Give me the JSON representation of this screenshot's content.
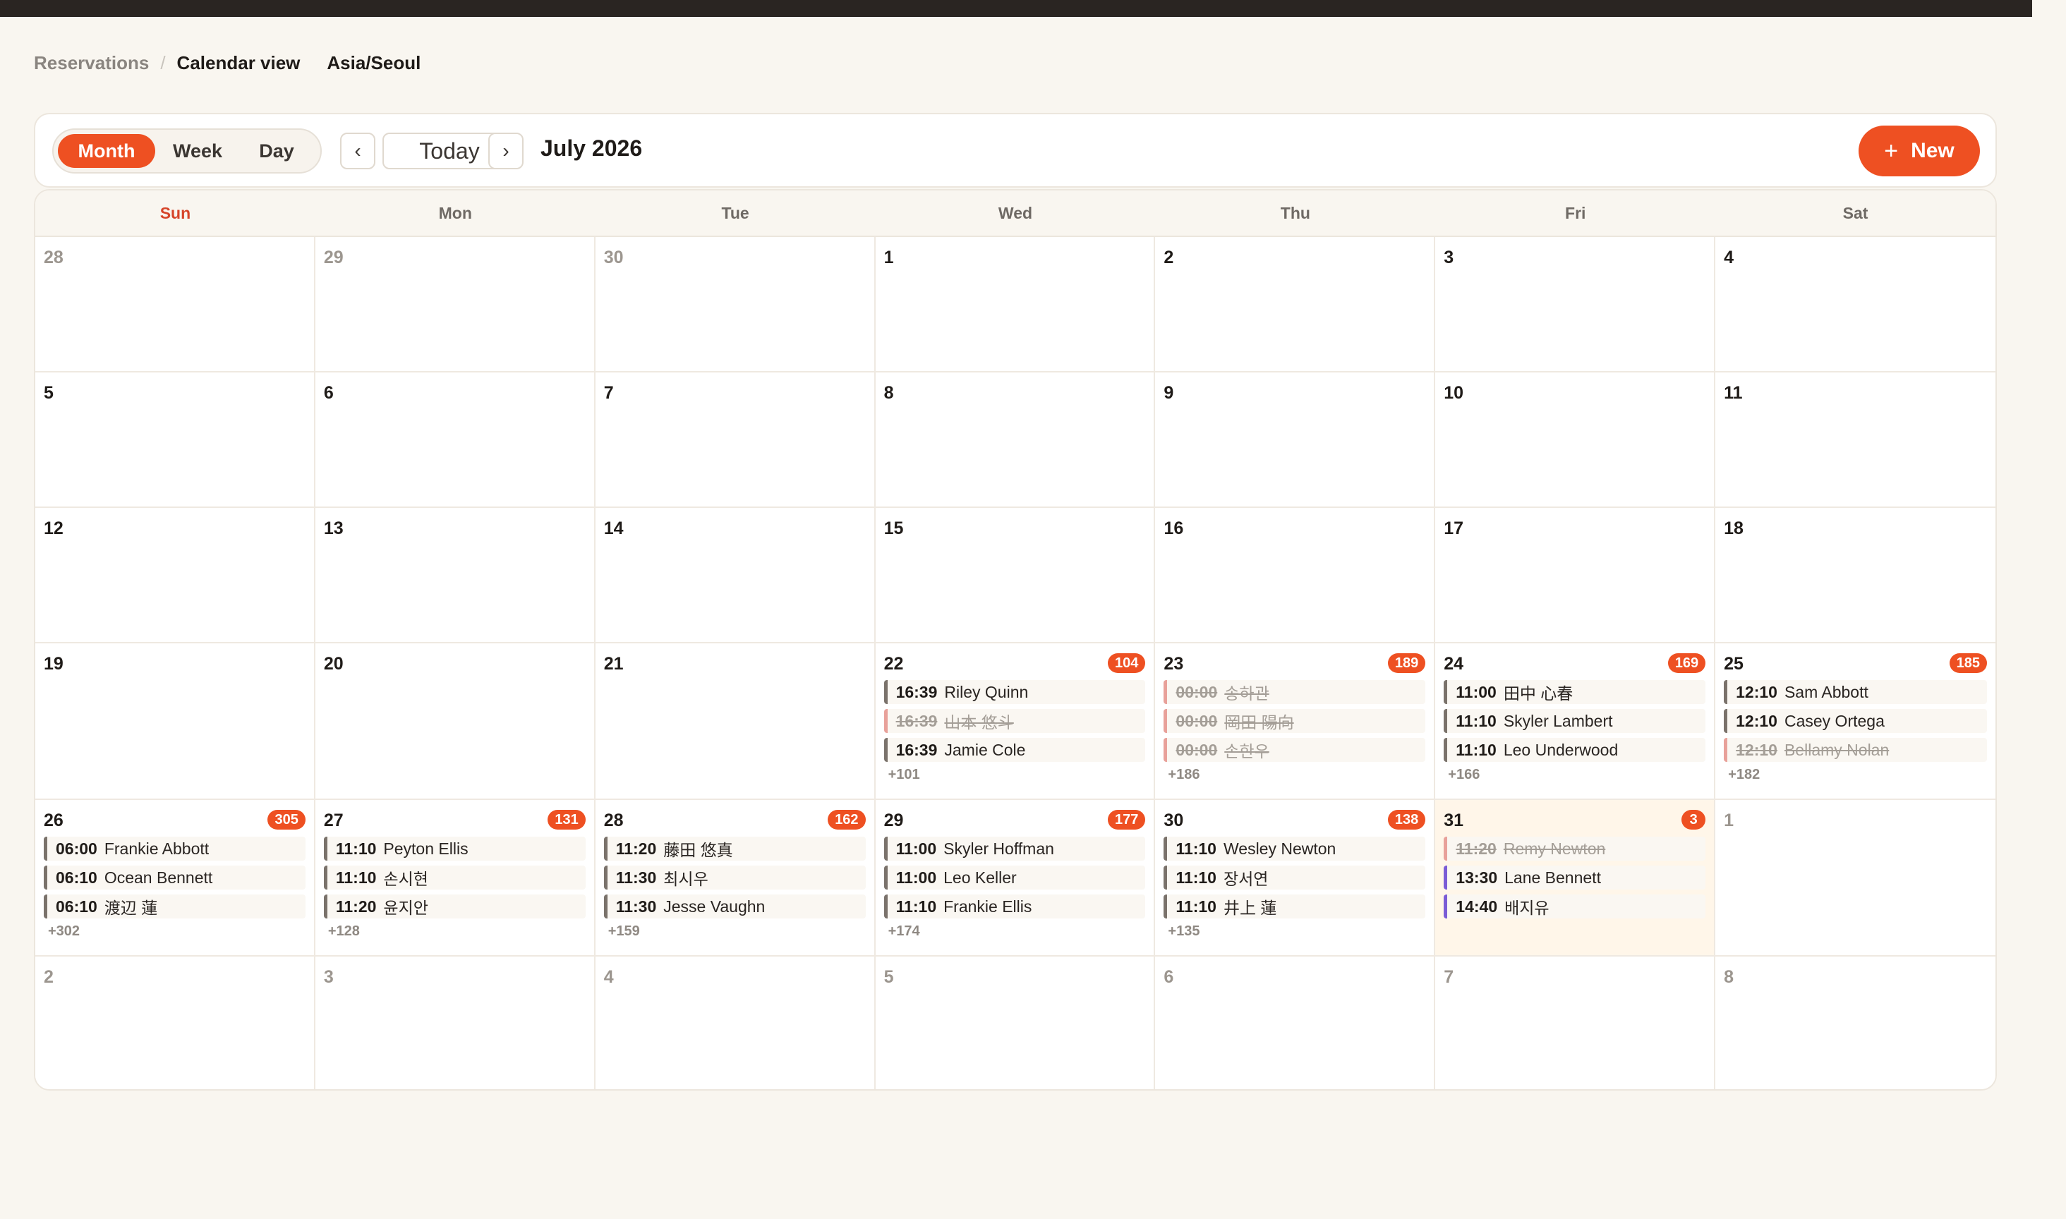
{
  "breadcrumb": {
    "items": [
      "Reservations",
      "Calendar view"
    ],
    "separator": "/",
    "timezone": "Asia/Seoul"
  },
  "toolbar": {
    "views": [
      "Month",
      "Week",
      "Day"
    ],
    "active_view": "Month",
    "prev_label": "‹",
    "today_label": "Today",
    "next_label": "›",
    "month_label": "July 2026",
    "new_label": "New",
    "new_icon": "+"
  },
  "weekdays": [
    "Sun",
    "Mon",
    "Tue",
    "Wed",
    "Thu",
    "Fri",
    "Sat"
  ],
  "colors": {
    "accent": "#ee5022",
    "cancelled": "#e8a19a",
    "default_event": "#7a726b",
    "purple_event": "#7a5cd6",
    "today_bg": "#fff6e9"
  },
  "days": [
    {
      "num": "28",
      "other": true
    },
    {
      "num": "29",
      "other": true
    },
    {
      "num": "30",
      "other": true
    },
    {
      "num": "1"
    },
    {
      "num": "2"
    },
    {
      "num": "3"
    },
    {
      "num": "4"
    },
    {
      "num": "5"
    },
    {
      "num": "6"
    },
    {
      "num": "7"
    },
    {
      "num": "8"
    },
    {
      "num": "9"
    },
    {
      "num": "10"
    },
    {
      "num": "11"
    },
    {
      "num": "12"
    },
    {
      "num": "13"
    },
    {
      "num": "14"
    },
    {
      "num": "15"
    },
    {
      "num": "16"
    },
    {
      "num": "17"
    },
    {
      "num": "18"
    },
    {
      "num": "19"
    },
    {
      "num": "20"
    },
    {
      "num": "21"
    },
    {
      "num": "22",
      "badge": "104",
      "events": [
        {
          "time": "16:39",
          "name": "Riley Quinn"
        },
        {
          "time": "16:39",
          "name": "山本 悠斗",
          "status": "cancelled"
        },
        {
          "time": "16:39",
          "name": "Jamie Cole"
        }
      ],
      "more": "+101"
    },
    {
      "num": "23",
      "badge": "189",
      "events": [
        {
          "time": "00:00",
          "name": "송하관",
          "status": "cancelled"
        },
        {
          "time": "00:00",
          "name": "岡田 陽向",
          "status": "cancelled"
        },
        {
          "time": "00:00",
          "name": "손한우",
          "status": "cancelled"
        }
      ],
      "more": "+186"
    },
    {
      "num": "24",
      "badge": "169",
      "events": [
        {
          "time": "11:00",
          "name": "田中 心春"
        },
        {
          "time": "11:10",
          "name": "Skyler Lambert"
        },
        {
          "time": "11:10",
          "name": "Leo Underwood"
        }
      ],
      "more": "+166"
    },
    {
      "num": "25",
      "badge": "185",
      "events": [
        {
          "time": "12:10",
          "name": "Sam Abbott"
        },
        {
          "time": "12:10",
          "name": "Casey Ortega"
        },
        {
          "time": "12:10",
          "name": "Bellamy Nolan",
          "status": "cancelled"
        }
      ],
      "more": "+182"
    },
    {
      "num": "26",
      "badge": "305",
      "events": [
        {
          "time": "06:00",
          "name": "Frankie Abbott"
        },
        {
          "time": "06:10",
          "name": "Ocean Bennett"
        },
        {
          "time": "06:10",
          "name": "渡辺 蓮"
        }
      ],
      "more": "+302"
    },
    {
      "num": "27",
      "badge": "131",
      "events": [
        {
          "time": "11:10",
          "name": "Peyton Ellis"
        },
        {
          "time": "11:10",
          "name": "손시현"
        },
        {
          "time": "11:20",
          "name": "윤지안"
        }
      ],
      "more": "+128"
    },
    {
      "num": "28",
      "badge": "162",
      "events": [
        {
          "time": "11:20",
          "name": "藤田 悠真"
        },
        {
          "time": "11:30",
          "name": "최시우"
        },
        {
          "time": "11:30",
          "name": "Jesse Vaughn"
        }
      ],
      "more": "+159"
    },
    {
      "num": "29",
      "badge": "177",
      "events": [
        {
          "time": "11:00",
          "name": "Skyler Hoffman"
        },
        {
          "time": "11:00",
          "name": "Leo Keller"
        },
        {
          "time": "11:10",
          "name": "Frankie Ellis"
        }
      ],
      "more": "+174"
    },
    {
      "num": "30",
      "badge": "138",
      "events": [
        {
          "time": "11:10",
          "name": "Wesley Newton"
        },
        {
          "time": "11:10",
          "name": "장서연"
        },
        {
          "time": "11:10",
          "name": "井上 蓮"
        }
      ],
      "more": "+135"
    },
    {
      "num": "31",
      "badge": "3",
      "today": true,
      "events": [
        {
          "time": "11:20",
          "name": "Remy Newton",
          "status": "cancelled"
        },
        {
          "time": "13:30",
          "name": "Lane Bennett",
          "status": "purple"
        },
        {
          "time": "14:40",
          "name": "배지유",
          "status": "purple"
        }
      ]
    },
    {
      "num": "1",
      "other": true
    },
    {
      "num": "2",
      "other": true
    },
    {
      "num": "3",
      "other": true
    },
    {
      "num": "4",
      "other": true
    },
    {
      "num": "5",
      "other": true
    },
    {
      "num": "6",
      "other": true
    },
    {
      "num": "7",
      "other": true
    },
    {
      "num": "8",
      "other": true
    }
  ]
}
